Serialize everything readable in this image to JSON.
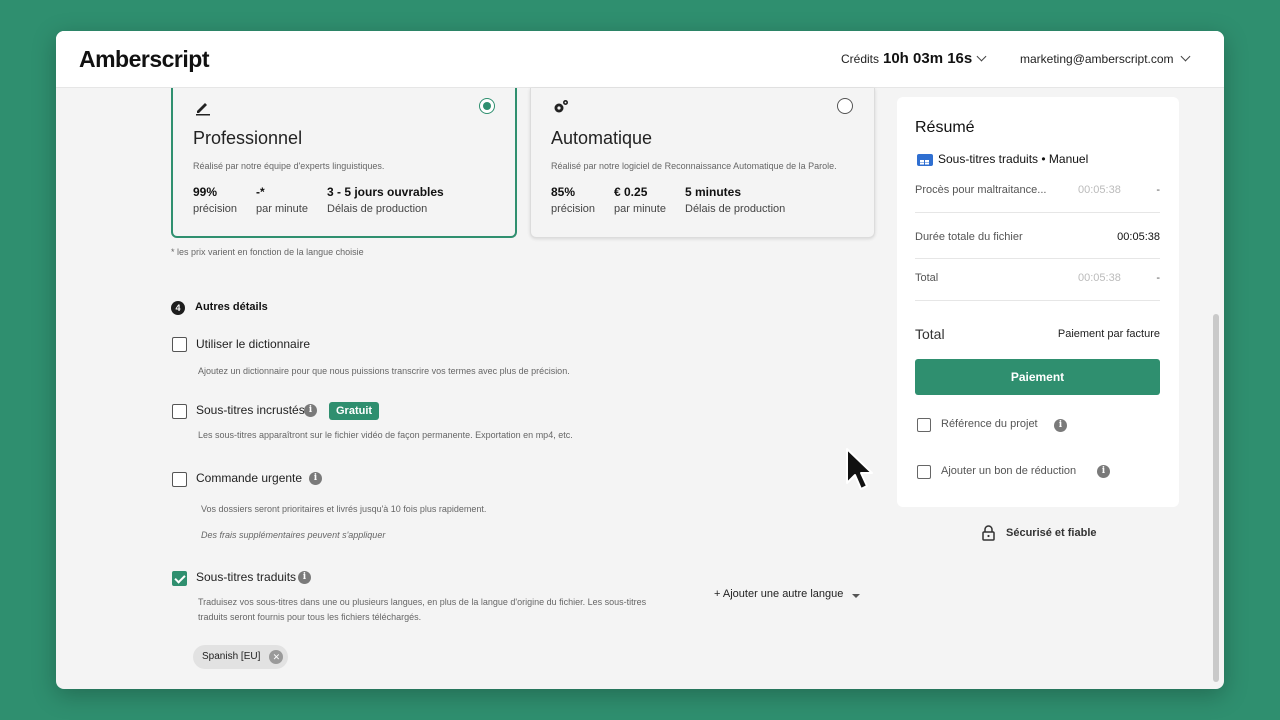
{
  "header": {
    "logo": "Amberscript",
    "credits_label": "Crédits",
    "credits_value": "10h 03m 16s",
    "user_email": "marketing@amberscript.com"
  },
  "plans": [
    {
      "title": "Professionnel",
      "description": "Réalisé par notre équipe d'experts linguistiques.",
      "selected": true,
      "stats": [
        {
          "value": "99%",
          "label": "précision"
        },
        {
          "value": "-*",
          "label": "par minute"
        },
        {
          "value": "3 - 5 jours ouvrables",
          "label": "Délais de production"
        }
      ]
    },
    {
      "title": "Automatique",
      "description": "Réalisé par notre logiciel de Reconnaissance Automatique de la Parole.",
      "selected": false,
      "stats": [
        {
          "value": "85%",
          "label": "précision"
        },
        {
          "value": "€ 0.25",
          "label": "par minute"
        },
        {
          "value": "5 minutes",
          "label": "Délais de production"
        }
      ]
    }
  ],
  "price_note": "* les prix varient en fonction de la langue choisie",
  "details": {
    "step_number": "4",
    "title": "Autres détails",
    "options": [
      {
        "label": "Utiliser le dictionnaire",
        "checked": false,
        "description": "Ajoutez un dictionnaire pour que nous puissions transcrire vos termes avec plus de précision."
      },
      {
        "label": "Sous-titres incrustés",
        "checked": false,
        "badge": "Gratuit",
        "description": "Les sous-titres apparaîtront sur le fichier vidéo de façon permanente. Exportation en mp4, etc."
      },
      {
        "label": "Commande urgente",
        "checked": false,
        "description": "Vos dossiers seront prioritaires et livrés jusqu'à 10 fois plus rapidement.",
        "note": "Des frais supplémentaires peuvent s'appliquer"
      },
      {
        "label": "Sous-titres traduits",
        "checked": true,
        "description_line1": "Traduisez vos sous-titres dans une ou plusieurs langues, en plus de la langue d'origine du fichier. Les sous-titres",
        "description_line2": "traduits seront fournis pour tous les fichiers téléchargés."
      }
    ],
    "add_language": "+ Ajouter une autre langue",
    "language_chip": "Spanish [EU]"
  },
  "summary": {
    "title": "Résumé",
    "service": "Sous-titres traduits • Manuel",
    "rows": [
      {
        "label": "Procès pour maltraitance...",
        "duration": "00:05:38",
        "price": "-"
      },
      {
        "label": "Durée totale du fichier",
        "value": "00:05:38"
      },
      {
        "label": "Total",
        "duration": "00:05:38",
        "price": "-"
      }
    ],
    "total_label": "Total",
    "total_value": "Paiement par facture",
    "pay_button": "Paiement",
    "project_reference": "Référence du projet",
    "discount": "Ajouter un bon de réduction"
  },
  "secure_label": "Sécurisé et fiable",
  "colors": {
    "accent": "#2f8f6f",
    "background": "#2f8f6f"
  }
}
